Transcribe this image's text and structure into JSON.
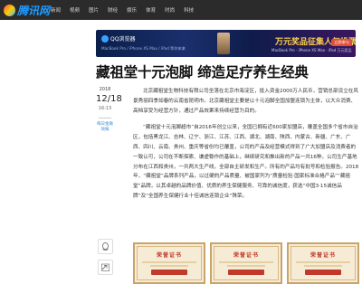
{
  "site": {
    "logo_text": "腾讯网",
    "nav": [
      "新闻",
      "视频",
      "图片",
      "财经",
      "娱乐",
      "体育",
      "时尚",
      "科技"
    ]
  },
  "ad": {
    "brand": "QQ浏览器",
    "subline": "MacBook Pro / iPhone XS Max / iPad 等你来拿",
    "title": "万元奖品征集人气投票",
    "caption": "MacBook Pro · iPhone XS Max · iPad 万元奖品",
    "cta": "立即参与",
    "colors": {
      "accent": "#ffd24a",
      "bg_start": "#0a1f4a",
      "bg_end": "#3b1760"
    }
  },
  "article": {
    "title": "藏祖堂十元泡脚 缔造足疗养生经典",
    "meta": {
      "year": "2018",
      "date": "12/18",
      "time": "16:13",
      "source": "每日金融快报"
    },
    "paragraphs": [
      "北京藏祖堂生物科技有限公司坐落在北京市海淀区，投入资金2000万人民币，营销总部设立在风景秀丽四季如春的云南省昆明市。北京藏祖堂主要是以十元泡脚全国加盟连锁为主体，以大众消费、高档享受为经营方针，通过产品效果来持续经营为目的。",
      "“藏祖堂十元泡脚超市”自2016年创立以来，全国已拥有近600家加盟店，覆盖全国多个省市自治区，包括黑龙江、吉林、辽宁、浙江、江苏、江西、湖北、湖南、陕西、内蒙古、新疆、广东、广西、四川、云南、贵州、重庆等省份均已覆盖，公司的产品及经营模式得到了广大加盟店及消费者的一致认可，公司在不断探索、谦虚稳作的基础上，继续研究和推出新的产品一共16种，公司生产基地分布在江西和贵州，一共两大生产线，全部自主研发和生产。所有的产品均有批号和检验报告。2018年，“藏祖堂”品牌系列产品，以过硬的产品质量、被国家列为“质量检验·国家标准合格产品”“藏祖堂”品牌，以其卓越的品牌价值、优质的养生保健服务、可靠的诚信度，获选“中国3·15诚信品牌”及“全国养生保健行业十佳诚信连锁企业”殊荣。"
    ],
    "certificates": [
      {
        "title": "荣誉证书"
      },
      {
        "title": "荣誉证书"
      },
      {
        "title": "荣誉证书"
      }
    ]
  }
}
